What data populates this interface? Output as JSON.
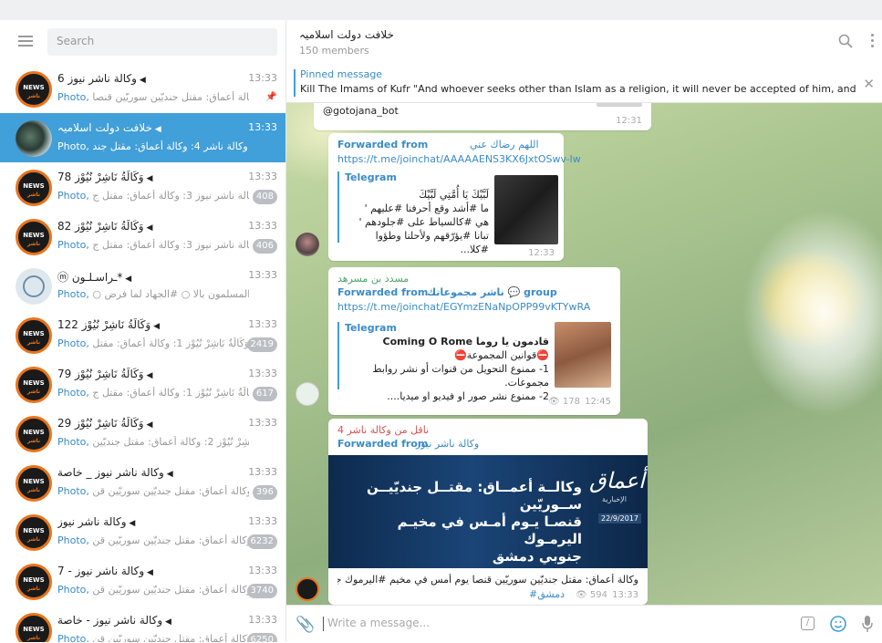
{
  "sidebar": {
    "search_placeholder": "Search",
    "chats": [
      {
        "name": "وكالة ناشر نيوز 6",
        "time": "13:33",
        "sender": "Photo,",
        "preview": "وكالة أعماق: مقتل جنديّين سوريّين قنصا...",
        "badge": "",
        "pinned": true,
        "avatar": "news",
        "active": false
      },
      {
        "name": "خلافت دولت اسلامیہ",
        "time": "13:33",
        "sender": "Photo,",
        "preview": "ناقل من وكالة ناشر 4: وكالة أعماق: مقتل جند...",
        "badge": "",
        "pinned": false,
        "avatar": "photo",
        "active": true
      },
      {
        "name": "وَكَالَةُ نَاشِرْ نُيُوْز 78",
        "time": "13:33",
        "sender": "Photo,",
        "preview": "وكالة ناشر نيوز 3: وكالة أعماق: مقتل ج...",
        "badge": "408",
        "pinned": false,
        "avatar": "news",
        "active": false
      },
      {
        "name": "وَكَالَةُ نَاشِرْ نُيُوْز 82",
        "time": "13:33",
        "sender": "Photo,",
        "preview": "وكالة ناشر نيوز 3: وكالة أعماق: مقتل ج...",
        "badge": "406",
        "pinned": false,
        "avatar": "news",
        "active": false
      },
      {
        "name": "*ـراسـلـون ⓜ",
        "time": "13:33",
        "sender": "Photo,",
        "preview": "○ أخذ #المسلمون بالا ○ #الجهاد لما فرض...",
        "badge": "",
        "pinned": false,
        "avatar": "logo",
        "active": false
      },
      {
        "name": "وَكَالَةُ نَاشِرْ نُيُوْز 122",
        "time": "13:33",
        "sender": "Photo,",
        "preview": "وَكَالَةُ نَاشِرْ نُيُوْز 1: وكالة أعماق: مقتل...",
        "badge": "2419",
        "pinned": false,
        "avatar": "news",
        "active": false
      },
      {
        "name": "وَكَالَةُ نَاشِرْ نُيُوْز 79",
        "time": "13:33",
        "sender": "Photo,",
        "preview": "وَكَالَةُ نَاشِرْ نُيُوْز 1: وكالة أعماق: مقتل ج...",
        "badge": "617",
        "pinned": false,
        "avatar": "news",
        "active": false
      },
      {
        "name": "وَكَالَةُ نَاشِرْ نُيُوْز 29",
        "time": "13:33",
        "sender": "Photo,",
        "preview": "وَكَالَةُ نَاشِرْ نُيُوْز 2: وكالة أعماق: مقتل جنديّين...",
        "badge": "",
        "pinned": false,
        "avatar": "news",
        "active": false
      },
      {
        "name": "وكالة ناشر نيوز _ خاصة",
        "time": "13:33",
        "sender": "Photo,",
        "preview": "وكالة أعماق: مقتل جنديّين سوريّين قن...",
        "badge": "396",
        "pinned": false,
        "avatar": "news",
        "active": false
      },
      {
        "name": "وكالة ناشر نيوز",
        "time": "13:33",
        "sender": "Photo,",
        "preview": "وكالة أعماق: مقتل جنديّين سوريّين قن...",
        "badge": "6232",
        "pinned": false,
        "avatar": "news",
        "active": false
      },
      {
        "name": "وكالة ناشر نيوز - 7",
        "time": "13:33",
        "sender": "Photo,",
        "preview": "وكالة أعماق: مقتل جنديّين سوريّين قن...",
        "badge": "3740",
        "pinned": false,
        "avatar": "news",
        "active": false
      },
      {
        "name": "وكالة ناشر نيوز - خاصة",
        "time": "13:33",
        "sender": "Photo,",
        "preview": "وكالة أعماق: مقتل جنديّين سوريّين قن...",
        "badge": "6250",
        "pinned": false,
        "avatar": "news",
        "active": false
      }
    ]
  },
  "header": {
    "title": "خلافت دولت اسلامیہ",
    "subtitle": "150 members"
  },
  "pinned": {
    "label": "Pinned message",
    "text": "Kill The Imams of Kufr  \"And whoever seeks other than Islam as a religion, it will never be accepted of him, and he will be ..."
  },
  "messages": {
    "m0": {
      "text": "@gotojana_bot",
      "time": "12:31"
    },
    "m1": {
      "fwd_name": "اللهم رضاك عني",
      "fwd_label": "Forwarded from",
      "link": "https://t.me/joinchat/AAAAAENS3KX6JxtOSwv-lw",
      "preview_label": "Telegram",
      "preview_lines": [
        "لَبَّيْكَ يَا أُمَّتِي لَبَّيْكَ",
        "ما #أشد وقع أحرفنا #عليهم '",
        "هي #كالسياط على #جلودهم '",
        "تبانا #يؤرّقهم ولأحلنا وطؤوا #كلا..."
      ],
      "time": "12:33"
    },
    "m2": {
      "sender": "مسدد بن مسرهد",
      "fwd_label": "Forwarded from",
      "fwd_name": "ناشر مجموعاتك 💬 group",
      "link": "https://t.me/joinchat/EGYmzENaNpOPP99vKTYwRA",
      "preview_label": "Telegram",
      "preview_lines": [
        "قادمون يا روما Coming O Rome",
        "⛔قوانين المجموعة⛔",
        "1- ممنوع التحويل من قنوات أو نشر روابط مجموعات.",
        "2- ممنوع نشر صور او فيديو او ميديا...."
      ],
      "views": "178",
      "time": "12:45"
    },
    "m3": {
      "sender": "ناقل من وكالة ناشر 4",
      "fwd_label": "Forwarded from",
      "fwd_name": "وكالة ناشر نيوز",
      "image_headline": [
        "وكالــة أعمــاق: مقتــل جنديّيــن ســوريّين",
        "قنصـا يـوم أمـس في مخيـم اليرمـوك",
        "جنوبي دمشق"
      ],
      "image_logo": "أعماق",
      "image_logo_sub": "الإخبارية",
      "image_date": "22/9/2017",
      "caption": "وكالة أعماق: مقتل جنديّين سوريّين قنصا يوم أمس في مخيم #اليرموك جنوبي",
      "caption2": "#دمشق",
      "views": "594",
      "time": "13:33"
    }
  },
  "composer": {
    "placeholder": "Write a message..."
  },
  "colors": {
    "accent": "#419fd9",
    "link": "#3a8bc7",
    "badge": "#bbbfc3"
  }
}
